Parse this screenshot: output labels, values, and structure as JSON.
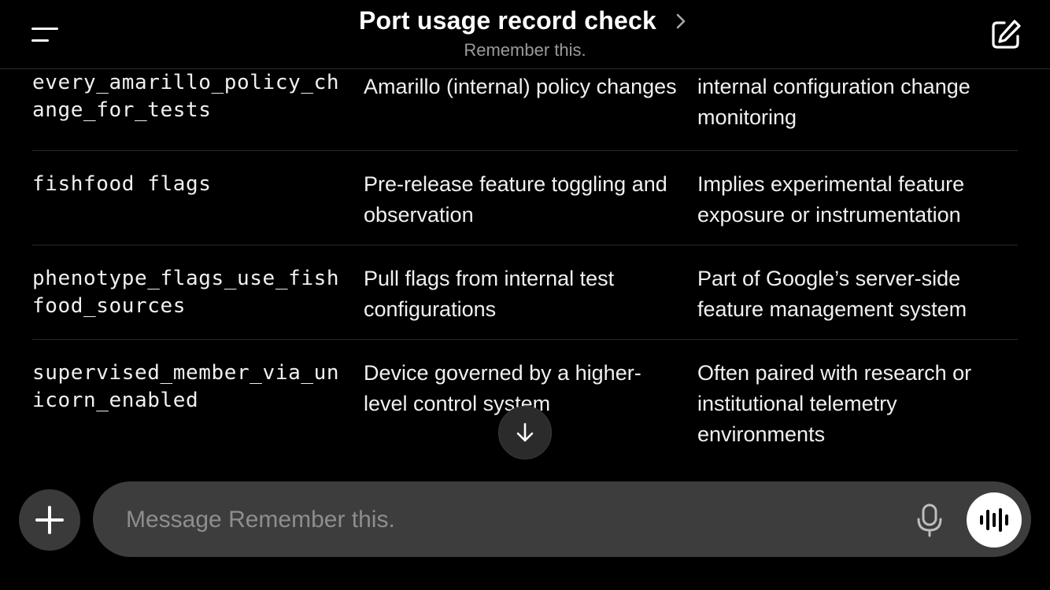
{
  "header": {
    "title": "Port usage record check",
    "subtitle": "Remember this.",
    "icons": {
      "menu": "menu-icon",
      "chevron": "chevron-right-icon",
      "compose": "compose-icon"
    }
  },
  "table": {
    "rows": [
      {
        "flag": "every_amarillo_policy_change_for_tests",
        "purpose": "Amarillo (internal) policy changes",
        "notes": "internal configuration change monitoring"
      },
      {
        "flag": "fishfood flags",
        "purpose": "Pre-release feature toggling and observation",
        "notes": "Implies experimental feature exposure or instrumentation"
      },
      {
        "flag": "phenotype_flags_use_fishfood_sources",
        "purpose": "Pull flags from internal test configurations",
        "notes": "Part of Google’s server-side feature management system"
      },
      {
        "flag": "supervised_member_via_unicorn_enabled",
        "purpose": "Device governed by a higher-level control system",
        "notes": "Often paired with research or institutional telemetry environments"
      }
    ]
  },
  "composer": {
    "placeholder": "Message Remember this.",
    "value": "",
    "icons": {
      "add": "plus-icon",
      "mic": "microphone-icon",
      "voice": "voice-waveform-icon",
      "scroll": "arrow-down-icon"
    }
  },
  "colors": {
    "background": "#000000",
    "input_bg": "#3d3d3d",
    "muted_text": "#9a9a9a",
    "divider": "#2a2a2a"
  }
}
